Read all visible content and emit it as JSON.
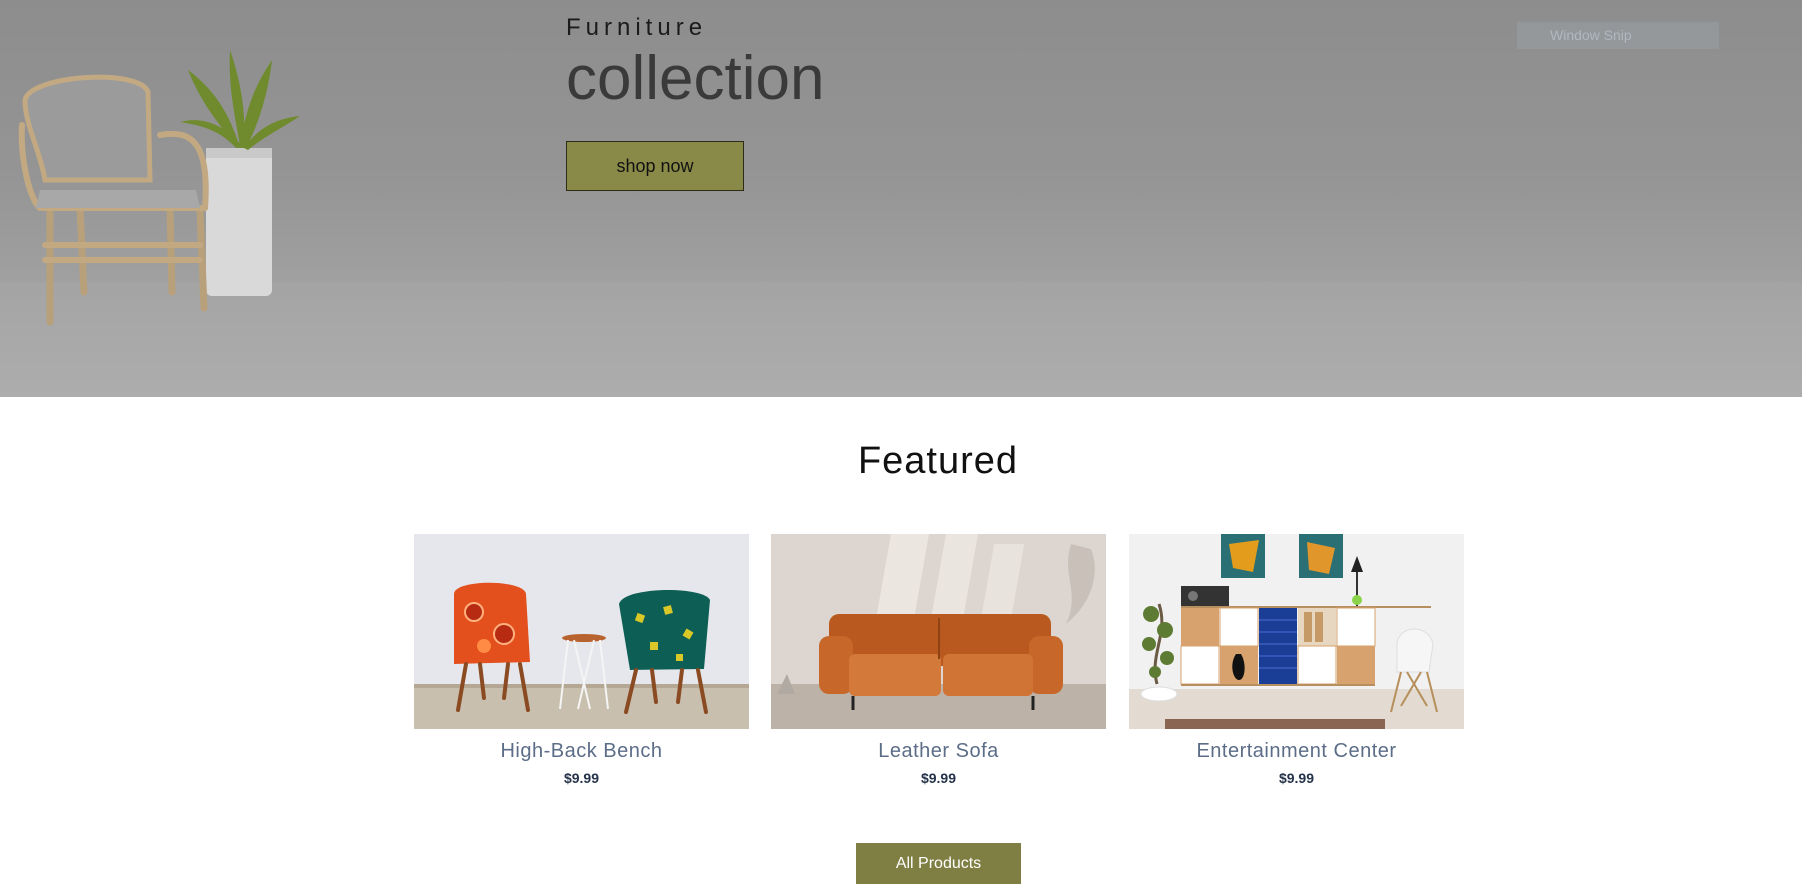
{
  "hero": {
    "subtitle": "Furniture",
    "title": "collection",
    "cta_label": "shop now",
    "snip_badge": "Window Snip"
  },
  "featured": {
    "title": "Featured",
    "products": [
      {
        "name": "High-Back Bench",
        "price": "$9.99",
        "image": "two-patterned-armchairs-photo"
      },
      {
        "name": "Leather Sofa",
        "price": "$9.99",
        "image": "orange-leather-sofa-photo"
      },
      {
        "name": "Entertainment Center",
        "price": "$9.99",
        "image": "cabinet-shelf-with-paintings-photo"
      }
    ],
    "all_label": "All Products"
  },
  "colors": {
    "accent": "#7f7f44",
    "hero_button": "#8a8a48",
    "product_name": "#5c6d87",
    "price": "#25334a"
  }
}
